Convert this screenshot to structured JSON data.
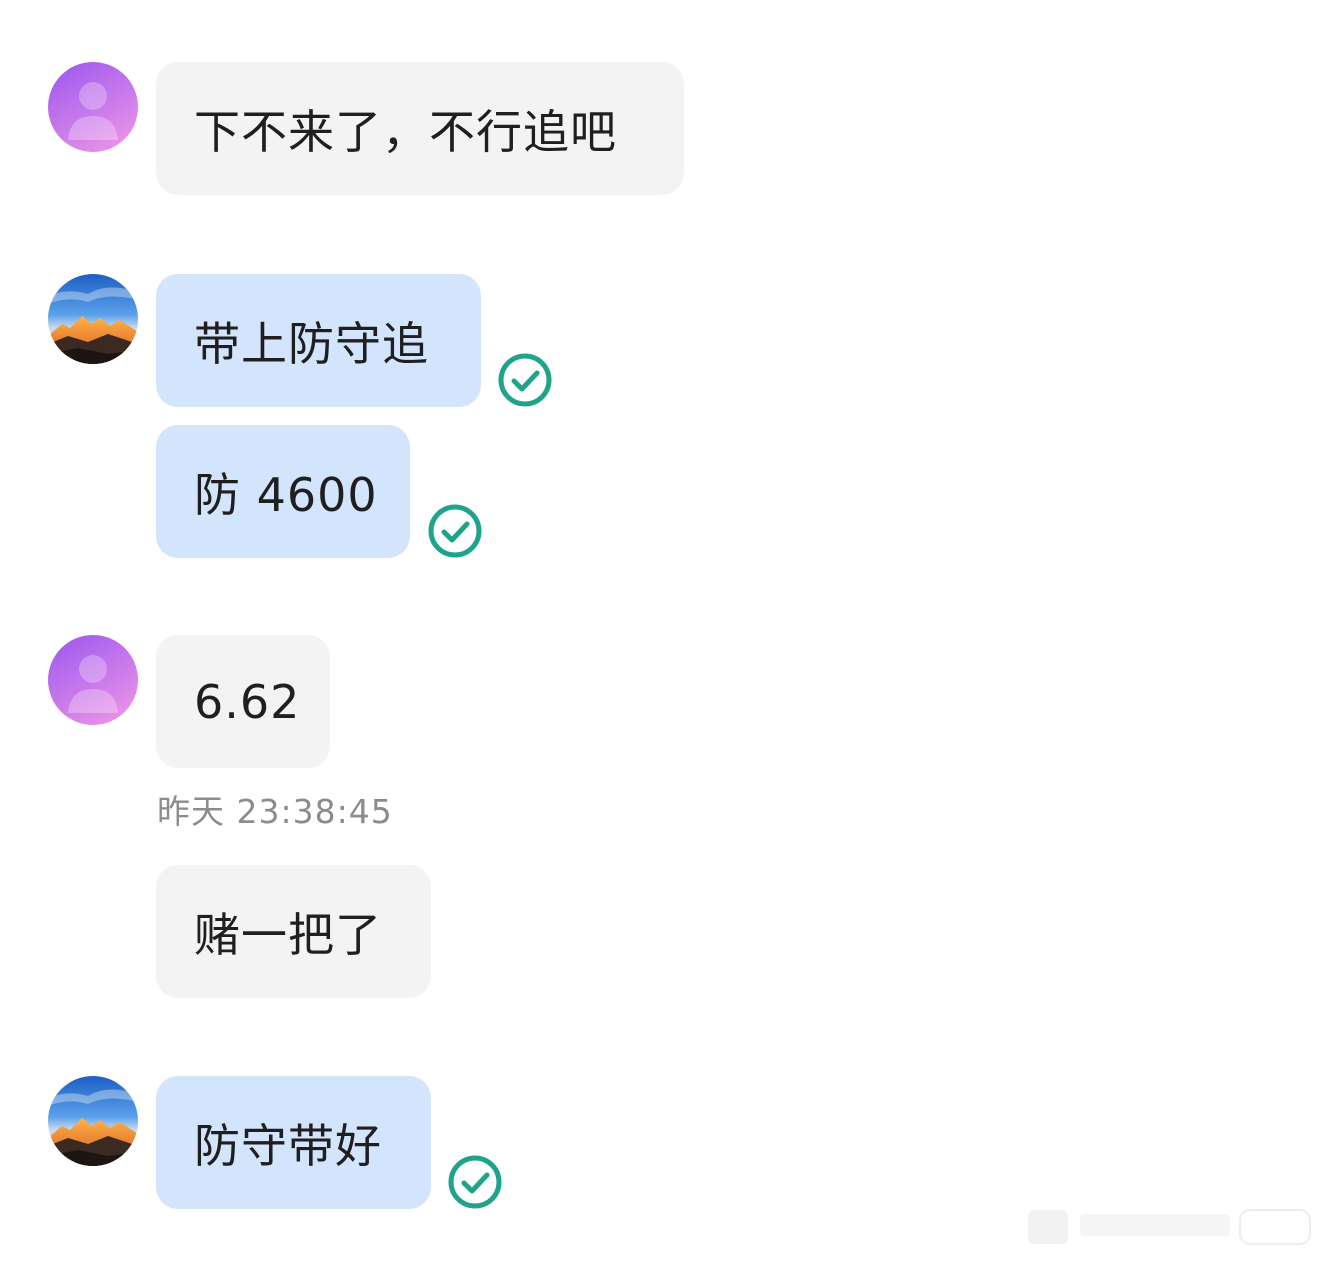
{
  "messages": [
    {
      "sender": "other",
      "text": "下不来了，不行追吧"
    },
    {
      "sender": "self",
      "text": "带上防守追",
      "status": "read"
    },
    {
      "sender": "self",
      "text": "防 4600",
      "status": "read"
    },
    {
      "sender": "other",
      "text": "6.62"
    },
    {
      "sender": "other",
      "text": "赌一把了"
    },
    {
      "sender": "self",
      "text": "防守带好",
      "status": "read"
    }
  ],
  "timestamp": "昨天 23:38:45",
  "colors": {
    "other_bubble": "#f3f3f3",
    "self_bubble": "#d3e4fd",
    "read_check": "#1fa38a",
    "timestamp_text": "#8c8c8c"
  },
  "icons": {
    "other_avatar": "default-person-avatar",
    "self_avatar": "mountain-sunset-avatar",
    "read_status": "check-circle-icon"
  }
}
